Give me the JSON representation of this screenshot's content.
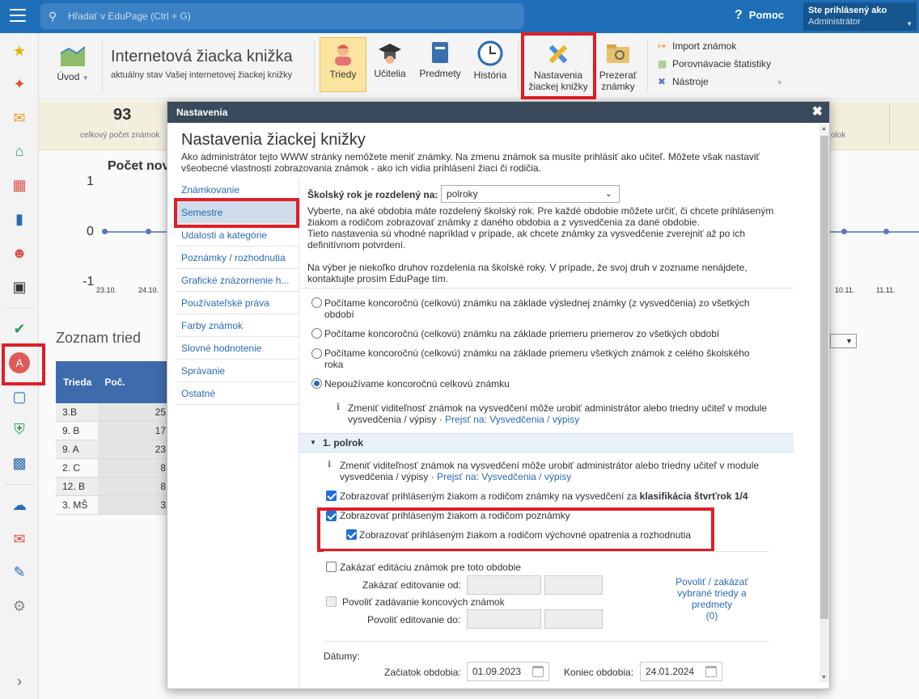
{
  "topbar": {
    "search_placeholder": "Hľadať v EduPage (Ctrl + G)",
    "help_label": "Pomoc",
    "user_label": "Ste prihlásený ako",
    "user_role": "Administrátor"
  },
  "ribbon": {
    "home_label": "Úvod",
    "title": "Internetová žiacka knižka",
    "subtitle": "aktuálny stav Vašej internetovej žiackej knižky",
    "buttons": {
      "classes": "Triedy",
      "teachers": "Učitelia",
      "subjects": "Predmety",
      "history": "História",
      "settings_line1": "Nastavenia",
      "settings_line2": "žiackej knižky",
      "browse_line1": "Prezerať",
      "browse_line2": "známky"
    },
    "import_label": "Import známok",
    "compare_label": "Porovnávacie štatistiky",
    "tools_label": "Nástroje"
  },
  "background": {
    "stat_value": "93",
    "stat_label": "celkový počet známok",
    "stat_right_label": "olok",
    "chart_title": "Počet nov",
    "y_ticks": [
      "1",
      "0",
      "-1"
    ],
    "x_ticks_left": [
      "23.10.",
      "24.10."
    ],
    "x_ticks_right": [
      "10.11.",
      "11.11."
    ],
    "list_title": "Zoznam tried",
    "table_headers": [
      "Trieda",
      "Poč. študentov"
    ],
    "table_rows": [
      {
        "name": "3.B",
        "count": "25"
      },
      {
        "name": "9. B",
        "count": "17"
      },
      {
        "name": "9. A",
        "count": "23"
      },
      {
        "name": "2. C",
        "count": "8"
      },
      {
        "name": "12. B",
        "count": "8"
      },
      {
        "name": "3. MŠ",
        "count": "3"
      }
    ]
  },
  "modal": {
    "header": "Nastavenia",
    "close": "✖",
    "title": "Nastavenia žiackej knižky",
    "description_1": "Ako administrátor tejto WWW stránky nemôžete meniť známky. Na zmenu známok sa musíte prihlásiť ako učiteľ. Môžete však nastaviť",
    "description_2": "všeobecné vlastnosti zobrazovania známok - ako ich vidia prihlásení žiaci či rodičia.",
    "menu": [
      "Známkovanie",
      "Semestre",
      "Udalosti a kategórie",
      "Poznámky / rozhodnutia",
      "Grafické znázornenie h...",
      "Používateľské práva",
      "Farby známok",
      "Slovné hodnotenie",
      "Správanie",
      "Ostatné"
    ],
    "year_split_label": "Školský rok je rozdelený na:",
    "year_split_value": "polroky",
    "year_help": [
      "Vyberte, na aké obdobia máte rozdelený školský rok. Pre každé obdobie môžete určiť, či chcete prihláseným",
      "žiakom a rodičom zobrazovať známky z daného obdobia a z vysvedčenia za dané obdobie.",
      "Tieto nastavenia sú vhodné napríklad v prípade, ak chcete známky za vysvedčenie zverejniť až po ich",
      "definitívnom potvrdení.",
      "Na výber je niekoľko druhov rozdelenia na školské roky. V prípade, že svoj druh v zozname nenájdete,",
      "kontaktujte prosím EduPage tím."
    ],
    "radios": [
      {
        "label_1": "Počítame koncoročnú (celkovú) známku na základe výslednej známky (z vysvedčenia) zo všetkých",
        "label_2": "období",
        "checked": false
      },
      {
        "label_1": "Počítame koncoročnú (celkovú) známku na základe priemeru priemerov zo všetkých období",
        "label_2": "",
        "checked": false
      },
      {
        "label_1": "Počítame koncoročnú (celkovú) známku na základe priemeru všetkých známok z celého školského",
        "label_2": "roka",
        "checked": false
      },
      {
        "label_1": "Nepoužívame koncoročnú celkovú známku",
        "label_2": "",
        "checked": true
      }
    ],
    "info_1_text": "Zmeniť viditeľnosť známok na vysvedčení môže urobiť administrátor alebo triedny učiteľ v module",
    "info_1_text2": "vysvedčenia / výpisy ·",
    "info_1_link": "Prejsť na: Vysvedčenia / výpisy",
    "section_title": "1. polrok",
    "info_2_text": "Zmeniť viditeľnosť známok na vysvedčení môže urobiť administrátor alebo triedny učiteľ v module",
    "info_2_text2": "vysvedčenia / výpisy ·",
    "info_2_link": "Prejsť na: Vysvedčenia / výpisy",
    "cb_report": "Zobrazovať prihláseným žiakom a rodičom známky na vysvedčení za",
    "cb_report_bold": "klasifikácia štvrťrok 1/4",
    "cb_notes": "Zobrazovať prihláseným žiakom a rodičom poznámky",
    "cb_measures": "Zobrazovať prihláseným žiakom a rodičom výchovné opatrenia a rozhodnutia",
    "cb_disable_edit": "Zakázať editáciu známok pre toto obdobie",
    "disable_from_label": "Zakázať editovanie od:",
    "cb_allow_final": "Povoliť zadávanie koncových známok",
    "allow_to_label": "Povoliť editovanie do:",
    "allow_link_1": "Povoliť / zakázať",
    "allow_link_2": "vybrané triedy a",
    "allow_link_3": "predmety",
    "allow_link_4": "(0)",
    "dates_label": "Dátumy:",
    "start_label": "Začiatok obdobia:",
    "start_value": "01.09.2023",
    "end_label": "Koniec obdobia:",
    "end_value": "24.01.2024"
  },
  "colors": {
    "accent": "#1e6fb8",
    "highlight": "#e01e26",
    "link": "#2a6ab5"
  }
}
